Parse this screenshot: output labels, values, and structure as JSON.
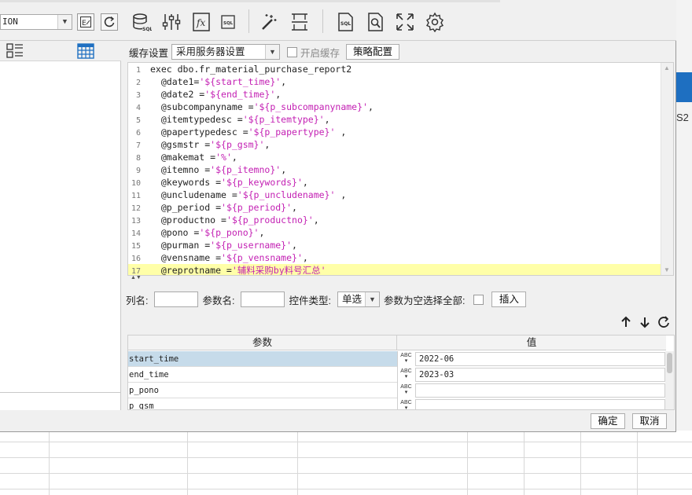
{
  "datasource": {
    "value": "ION"
  },
  "cache": {
    "label": "缓存设置",
    "option": "采用服务器设置",
    "enable_label": "开启缓存",
    "strategy_button": "策略配置"
  },
  "sql_lines": [
    [
      {
        "t": "exec dbo.fr_material_purchase_report2",
        "c": "kw"
      }
    ],
    [
      {
        "t": "  @date1=",
        "c": "kw"
      },
      {
        "t": "'${start_time}'",
        "c": "str"
      },
      {
        "t": ",",
        "c": "kw"
      }
    ],
    [
      {
        "t": "  @date2 =",
        "c": "kw"
      },
      {
        "t": "'${end_time}'",
        "c": "str"
      },
      {
        "t": ",",
        "c": "kw"
      }
    ],
    [
      {
        "t": "  @subcompanyname =",
        "c": "kw"
      },
      {
        "t": "'${p_subcompanyname}'",
        "c": "str"
      },
      {
        "t": ",",
        "c": "kw"
      }
    ],
    [
      {
        "t": "  @itemtypedesc =",
        "c": "kw"
      },
      {
        "t": "'${p_itemtype}'",
        "c": "str"
      },
      {
        "t": ",",
        "c": "kw"
      }
    ],
    [
      {
        "t": "  @papertypedesc =",
        "c": "kw"
      },
      {
        "t": "'${p_papertype}'",
        "c": "str"
      },
      {
        "t": " ,",
        "c": "kw"
      }
    ],
    [
      {
        "t": "  @gsmstr =",
        "c": "kw"
      },
      {
        "t": "'${p_gsm}'",
        "c": "str"
      },
      {
        "t": ",",
        "c": "kw"
      }
    ],
    [
      {
        "t": "  @makemat =",
        "c": "kw"
      },
      {
        "t": "'%'",
        "c": "str"
      },
      {
        "t": ",",
        "c": "kw"
      }
    ],
    [
      {
        "t": "  @itemno =",
        "c": "kw"
      },
      {
        "t": "'${p_itemno}'",
        "c": "str"
      },
      {
        "t": ",",
        "c": "kw"
      }
    ],
    [
      {
        "t": "  @keywords =",
        "c": "kw"
      },
      {
        "t": "'${p_keywords}'",
        "c": "str"
      },
      {
        "t": ",",
        "c": "kw"
      }
    ],
    [
      {
        "t": "  @uncludename =",
        "c": "kw"
      },
      {
        "t": "'${p_uncludename}'",
        "c": "str"
      },
      {
        "t": " ,",
        "c": "kw"
      }
    ],
    [
      {
        "t": "  @p_period =",
        "c": "kw"
      },
      {
        "t": "'${p_period}'",
        "c": "str"
      },
      {
        "t": ",",
        "c": "kw"
      }
    ],
    [
      {
        "t": "  @productno =",
        "c": "kw"
      },
      {
        "t": "'${p_productno}'",
        "c": "str"
      },
      {
        "t": ",",
        "c": "kw"
      }
    ],
    [
      {
        "t": "  @pono =",
        "c": "kw"
      },
      {
        "t": "'${p_pono}'",
        "c": "str"
      },
      {
        "t": ",",
        "c": "kw"
      }
    ],
    [
      {
        "t": "  @purman =",
        "c": "kw"
      },
      {
        "t": "'${p_username}'",
        "c": "str"
      },
      {
        "t": ",",
        "c": "kw"
      }
    ],
    [
      {
        "t": "  @vensname =",
        "c": "kw"
      },
      {
        "t": "'${p_vensname}'",
        "c": "str"
      },
      {
        "t": ",",
        "c": "kw"
      }
    ],
    [
      {
        "t": "  @reprotname =",
        "c": "kw"
      },
      {
        "t": "'辅料采购by料号汇总'",
        "c": "str"
      }
    ]
  ],
  "param_form": {
    "col_label": "列名:",
    "param_label": "参数名:",
    "control_type_label": "控件类型:",
    "control_type_value": "单选",
    "empty_select_all_label": "参数为空选择全部:",
    "insert_button": "插入"
  },
  "param_table": {
    "headers": [
      "参数",
      "值"
    ],
    "type_glyph": "ABC",
    "rows": [
      {
        "name": "start_time",
        "value": "2022-06",
        "selected": true
      },
      {
        "name": "end_time",
        "value": "2023-03",
        "selected": false
      },
      {
        "name": "p_pono",
        "value": "",
        "selected": false
      },
      {
        "name": "p_gsm",
        "value": "",
        "selected": false
      }
    ]
  },
  "footer": {
    "ok": "确定",
    "cancel": "取消"
  },
  "background": {
    "right_text": "S2"
  },
  "colors": {
    "highlight_line": "#ffffa8",
    "string": "#c31fb3",
    "selected_row": "#c6dbea",
    "accent_blue": "#1e6fc1"
  }
}
